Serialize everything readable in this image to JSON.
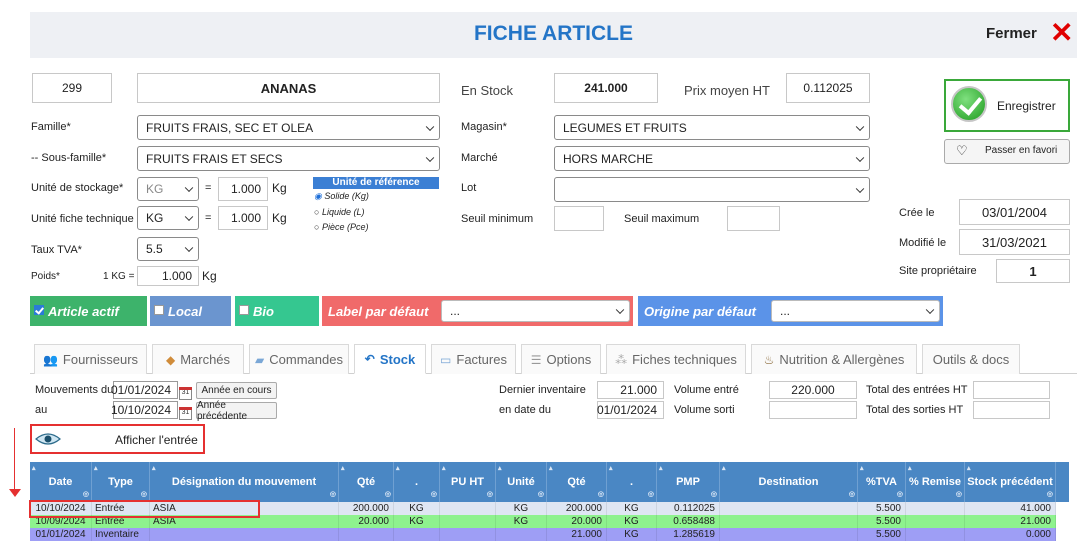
{
  "header": {
    "title": "FICHE ARTICLE",
    "close_label": "Fermer"
  },
  "article": {
    "code": "299",
    "name": "ANANAS"
  },
  "stock": {
    "label": "En Stock",
    "value": "241.000",
    "prix_label": "Prix moyen HT",
    "prix_value": "0.112025"
  },
  "save_button": {
    "label": "Enregistrer"
  },
  "favori_button": {
    "label": "Passer en favori"
  },
  "left_fields": {
    "famille_label": "Famille*",
    "famille_value": "FRUITS FRAIS, SEC ET OLEA",
    "sousfamille_label": "-- Sous-famille*",
    "sousfamille_value": "FRUITS FRAIS ET SECS",
    "unite_stockage_label": "Unité de stockage*",
    "unite_stockage_value": "KG",
    "unite_stockage_qty": "1.000",
    "unite_stockage_unit": "Kg",
    "unite_fiche_label": "Unité fiche technique",
    "unite_fiche_value": "KG",
    "unite_fiche_qty": "1.000",
    "unite_fiche_unit": "Kg",
    "equals": "=",
    "tva_label": "Taux TVA*",
    "tva_value": "5.5",
    "poids_label": "Poids*",
    "poids_prefix": "1 KG =",
    "poids_value": "1.000",
    "poids_unit": "Kg"
  },
  "unite_reference": {
    "title": "Unité de référence",
    "options": [
      "Solide  (Kg)",
      "Liquide (L)",
      "Pièce (Pce)"
    ],
    "selected": "Solide  (Kg)"
  },
  "middle_fields": {
    "magasin_label": "Magasin*",
    "magasin_value": "LEGUMES ET FRUITS",
    "marche_label": "Marché",
    "marche_value": "HORS MARCHE",
    "lot_label": "Lot",
    "lot_value": "",
    "seuil_min_label": "Seuil minimum",
    "seuil_min_value": "",
    "seuil_max_label": "Seuil maximum",
    "seuil_max_value": ""
  },
  "right_fields": {
    "cree_label": "Crée le",
    "cree_value": "03/01/2004",
    "modifie_label": "Modifié le",
    "modifie_value": "31/03/2021",
    "site_label": "Site propriétaire",
    "site_value": "1"
  },
  "flags": {
    "article_actif": "Article actif",
    "local": "Local",
    "bio": "Bio",
    "label_defaut": "Label par défaut",
    "label_defaut_value": "...",
    "origine_defaut": "Origine par défaut",
    "origine_defaut_value": "..."
  },
  "tabs": [
    {
      "label": "Fournisseurs",
      "icon": "users-icon"
    },
    {
      "label": "Marchés",
      "icon": "tag-icon"
    },
    {
      "label": "Commandes",
      "icon": "cart-icon"
    },
    {
      "label": "Stock",
      "icon": "undo-arrow-icon",
      "active": true
    },
    {
      "label": "Factures",
      "icon": "invoice-icon"
    },
    {
      "label": "Options",
      "icon": "options-icon"
    },
    {
      "label": "Fiches techniques",
      "icon": "doc-icon"
    },
    {
      "label": "Nutrition & Allergènes",
      "icon": "nutrition-icon"
    },
    {
      "label": "Outils & docs",
      "icon": ""
    }
  ],
  "stock_panel": {
    "mouvements_label": "Mouvements du",
    "du_value": "01/01/2024",
    "annee_en_cours": "Année en cours",
    "au_label": "au",
    "au_value": "10/10/2024",
    "annee_precedente": "Année précédente",
    "dernier_inventaire_label": "Dernier inventaire",
    "dernier_inventaire_value": "21.000",
    "en_date_du_label": "en date du",
    "en_date_du_value": "01/01/2024",
    "volume_entre_label": "Volume entré",
    "volume_entre_value": "220.000",
    "volume_sorti_label": "Volume sorti",
    "volume_sorti_value": "",
    "total_entrees_label": "Total des entrées HT",
    "total_entrees_value": "",
    "total_sorties_label": "Total des sorties HT",
    "total_sorties_value": "",
    "afficher_label": "Afficher l'entrée",
    "calendar_glyph": "31"
  },
  "grid": {
    "columns": [
      "Date",
      "Type",
      "Désignation du mouvement",
      "Qté",
      ".",
      "PU HT",
      "Unité",
      "Qté",
      ".",
      "PMP",
      "Destination",
      "%TVA",
      "% Remise",
      "Stock précédent"
    ],
    "rows": [
      [
        "10/10/2024",
        "Entrée",
        "ASIA",
        "200.000",
        "KG",
        "",
        "KG",
        "200.000",
        "KG",
        "0.112025",
        "",
        "5.500",
        "",
        "41.000"
      ],
      [
        "10/09/2024",
        "Entrée",
        "ASIA",
        "20.000",
        "KG",
        "",
        "KG",
        "20.000",
        "KG",
        "0.658488",
        "",
        "5.500",
        "",
        "21.000"
      ],
      [
        "01/01/2024",
        "Inventaire",
        "",
        "",
        "",
        "",
        "",
        "21.000",
        "KG",
        "1.285619",
        "",
        "5.500",
        "",
        "0.000"
      ]
    ],
    "row_colors": [
      "#dfe6f3",
      "#8ef28e",
      "#9e9ef5"
    ]
  }
}
